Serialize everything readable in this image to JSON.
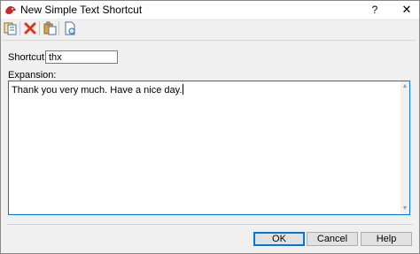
{
  "window": {
    "title": "New Simple Text Shortcut",
    "help_label": "?",
    "close_label": "✕"
  },
  "toolbar": {
    "icons": [
      "copy-icon",
      "delete-icon",
      "paste-icon",
      "document-icon"
    ]
  },
  "form": {
    "shortcut_label": "Shortcut:",
    "shortcut_value": "thx",
    "expansion_label": "Expansion:",
    "expansion_value": "Thank you very much. Have a nice day."
  },
  "buttons": {
    "ok": "OK",
    "cancel": "Cancel",
    "help": "Help"
  },
  "colors": {
    "focus_blue": "#0078d7",
    "delete_red": "#d9381e"
  }
}
